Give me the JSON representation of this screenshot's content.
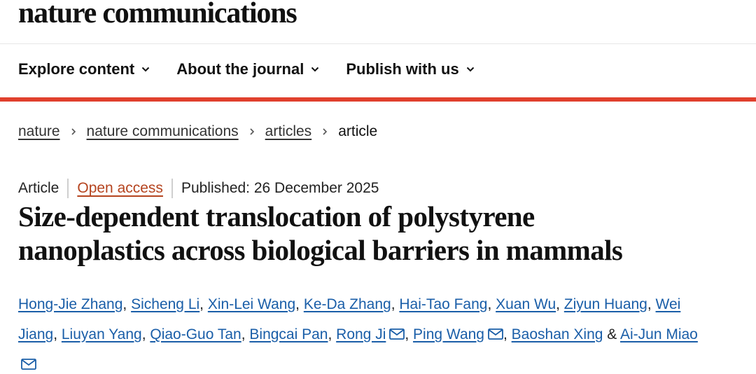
{
  "header": {
    "logo": "nature communications"
  },
  "nav": {
    "items": [
      {
        "label": "Explore content"
      },
      {
        "label": "About the journal"
      },
      {
        "label": "Publish with us"
      }
    ]
  },
  "breadcrumb": {
    "items": [
      "nature",
      "nature communications",
      "articles"
    ],
    "current": "article"
  },
  "meta": {
    "type": "Article",
    "access": "Open access",
    "published": "Published: 26 December 2025"
  },
  "article": {
    "title_line1": "Size-dependent translocation of polystyrene",
    "title_line2": "nanoplastics across biological barriers in mammals"
  },
  "authors": {
    "list": [
      "Hong-Jie Zhang",
      "Sicheng Li",
      "Xin-Lei Wang",
      "Ke-Da Zhang",
      "Hai-Tao Fang",
      "Xuan Wu",
      "Ziyun Huang",
      "Wei Jiang",
      "Liuyan Yang",
      "Qiao-Guo Tan",
      "Bingcai Pan",
      "Rong Ji",
      "Ping Wang",
      "Baoshan Xing",
      "Ai-Jun Miao"
    ],
    "wei_first": "Wei",
    "wei_second": "Jiang",
    "comma": ", ",
    "ampersand": " & "
  },
  "colors": {
    "accent_red": "#e0402d",
    "open_access": "#b5441f",
    "link_blue": "#1a5ea8"
  },
  "icons": {
    "nav_chevron": "chevron-down-icon",
    "breadcrumb_sep": "chevron-right-icon",
    "email": "envelope-icon"
  }
}
